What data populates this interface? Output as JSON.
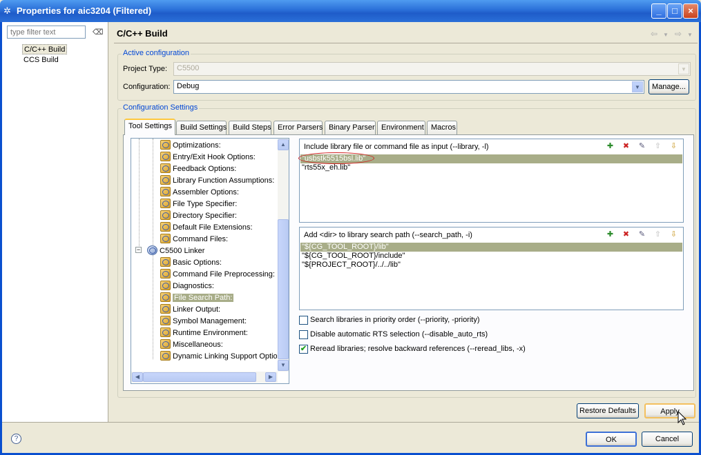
{
  "window": {
    "title": "Properties for aic3204 (Filtered)",
    "min": "_",
    "max": "□",
    "close": "×"
  },
  "left": {
    "filter_placeholder": "type filter text",
    "nav": [
      "C/C++ Build",
      "CCS Build"
    ]
  },
  "right": {
    "title": "C/C++ Build",
    "back_arrow": "⇦",
    "forward_arrow": "⇨",
    "active_config": {
      "group_title": "Active configuration",
      "project_type_label": "Project Type:",
      "project_type_value": "C5500",
      "configuration_label": "Configuration:",
      "configuration_value": "Debug",
      "manage_button": "Manage..."
    },
    "config_settings": {
      "group_title": "Configuration Settings",
      "tabs": [
        "Tool Settings",
        "Build Settings",
        "Build Steps",
        "Error Parsers",
        "Binary Parser",
        "Environment",
        "Macros"
      ],
      "tree": [
        "Optimizations:",
        "Entry/Exit Hook Options:",
        "Feedback Options:",
        "Library Function Assumptions:",
        "Assembler Options:",
        "File Type Specifier:",
        "Directory Specifier:",
        "Default File Extensions:",
        "Command Files:",
        "C5500 Linker",
        "Basic Options:",
        "Command File Preprocessing:",
        "Diagnostics:",
        "File Search Path:",
        "Linker Output:",
        "Symbol Management:",
        "Runtime Environment:",
        "Miscellaneous:",
        "Dynamic Linking Support Option"
      ],
      "library_list": {
        "header": "Include library file or command file as input (--library, -l)",
        "items": [
          "\"usbstk5515bsl.lib\"",
          "\"rts55x_eh.lib\""
        ]
      },
      "search_path_list": {
        "header": "Add <dir> to library search path (--search_path, -i)",
        "items": [
          "\"${CG_TOOL_ROOT}/lib\"",
          "\"${CG_TOOL_ROOT}/include\"",
          "\"${PROJECT_ROOT}/../../lib\""
        ]
      },
      "checkboxes": [
        {
          "label": "Search libraries in priority order (--priority, -priority)",
          "checked": false
        },
        {
          "label": "Disable automatic RTS selection (--disable_auto_rts)",
          "checked": false
        },
        {
          "label": "Reread libraries; resolve backward references (--reread_libs, -x)",
          "checked": true
        }
      ]
    },
    "restore_defaults_button": "Restore Defaults",
    "apply_button": "Apply"
  },
  "footer": {
    "help": "?",
    "ok_button": "OK",
    "cancel_button": "Cancel"
  },
  "icons": {
    "check": "✔",
    "combo_arrow": "▼",
    "up": "▲",
    "down": "▼",
    "left": "◀",
    "right": "▶",
    "expander": "−"
  },
  "colors": {
    "title_bar": "#2a6fd8",
    "selection": "#a8ad88",
    "group_title": "#0046d5",
    "annotation": "#d02020"
  }
}
